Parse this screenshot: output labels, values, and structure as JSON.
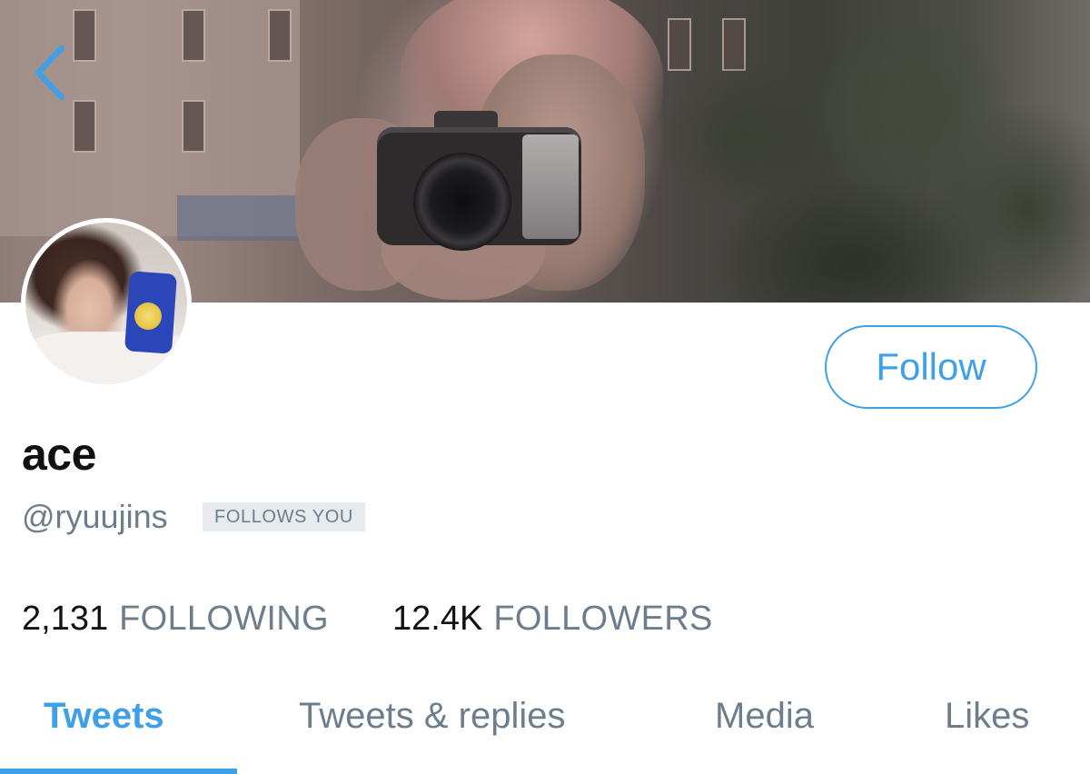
{
  "profile": {
    "display_name": "ace",
    "handle": "@ryuujins",
    "follows_you_badge": "FOLLOWS YOU"
  },
  "actions": {
    "follow_label": "Follow",
    "back_icon": "chevron-left-icon"
  },
  "stats": {
    "following": {
      "count": "2,131",
      "label": "FOLLOWING"
    },
    "followers": {
      "count": "12.4K",
      "label": "FOLLOWERS"
    }
  },
  "tabs": [
    {
      "label": "Tweets",
      "active": true
    },
    {
      "label": "Tweets & replies",
      "active": false
    },
    {
      "label": "Media",
      "active": false
    },
    {
      "label": "Likes",
      "active": false
    }
  ],
  "colors": {
    "accent": "#3ea0e8",
    "secondary_text": "#6e7d8b",
    "primary_text": "#111111",
    "badge_bg": "#e7ebee"
  }
}
